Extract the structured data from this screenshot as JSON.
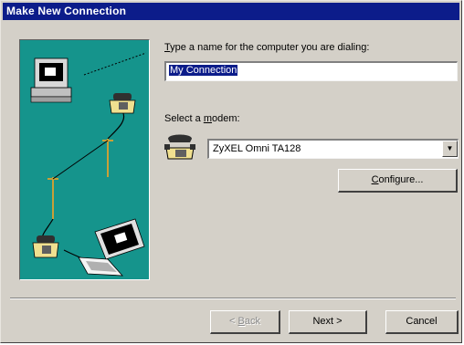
{
  "window": {
    "title": "Make New Connection"
  },
  "name_field": {
    "label_mnemonic": "T",
    "label_rest": "ype a name for the computer you are dialing:",
    "value": "My Connection"
  },
  "modem": {
    "label_pre": "Select a ",
    "label_mnemonic": "m",
    "label_post": "odem:",
    "selected": "ZyXEL Omni TA128",
    "dropdown_icon": "chevron-down-icon"
  },
  "configure_button": {
    "mnemonic": "C",
    "rest": "onfigure..."
  },
  "buttons": {
    "back_pre": "< ",
    "back_mnemonic": "B",
    "back_post": "ack",
    "next": "Next >",
    "cancel": "Cancel"
  },
  "colors": {
    "titlebar": "#0c1c8a",
    "dialog_face": "#d4d0c8",
    "illustration_bg": "#15948c"
  }
}
